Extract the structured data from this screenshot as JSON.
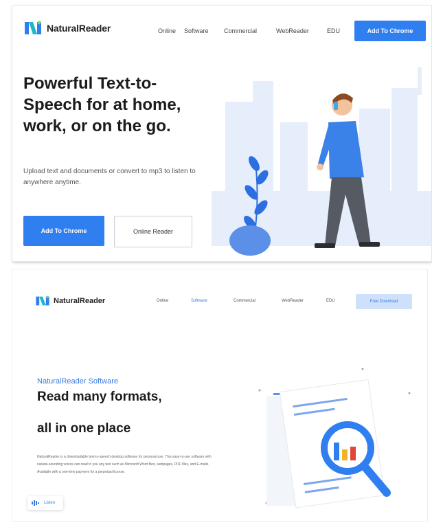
{
  "panel1": {
    "brand": "NaturalReader",
    "nav": [
      "Online",
      "Software",
      "Commercial",
      "WebReader",
      "EDU"
    ],
    "cta": "Add To Chrome",
    "headline": [
      "Powerful Text-to-",
      "Speech for at home,",
      "work, or on the go."
    ],
    "subtitle": "Upload text and documents or convert to mp3 to listen to anywhere anytime.",
    "primary_button": "Add To Chrome",
    "secondary_button": "Online Reader",
    "colors": {
      "accent": "#2f7ff0",
      "sky": "#e6eefb",
      "leaf": "#2d6fe0"
    }
  },
  "panel2": {
    "brand": "NaturalReader",
    "nav": [
      "Online",
      "Software",
      "Commercial",
      "WebReader",
      "EDU"
    ],
    "active_nav": "Software",
    "cta": "Free Download",
    "kicker": "NaturalReader Software",
    "title_line1": "Read many formats,",
    "title_line2": "all in one place",
    "description": "NaturalReader is a downloadable text-to-speech desktop software for personal use. This easy-to-use software with natural-sounding voices can read to you any text such as Microsoft Word files, webpages, PDF files, and E-mails. Available with a one-time payment for a perpetual license.",
    "listen_label": "Listen",
    "colors": {
      "accent": "#3a7be0",
      "cta_bg": "#cfe0fb"
    }
  },
  "icons": {
    "logo": "naturalreader-logo-icon",
    "listen": "speaker-icon",
    "magnifier": "magnifier-icon"
  }
}
